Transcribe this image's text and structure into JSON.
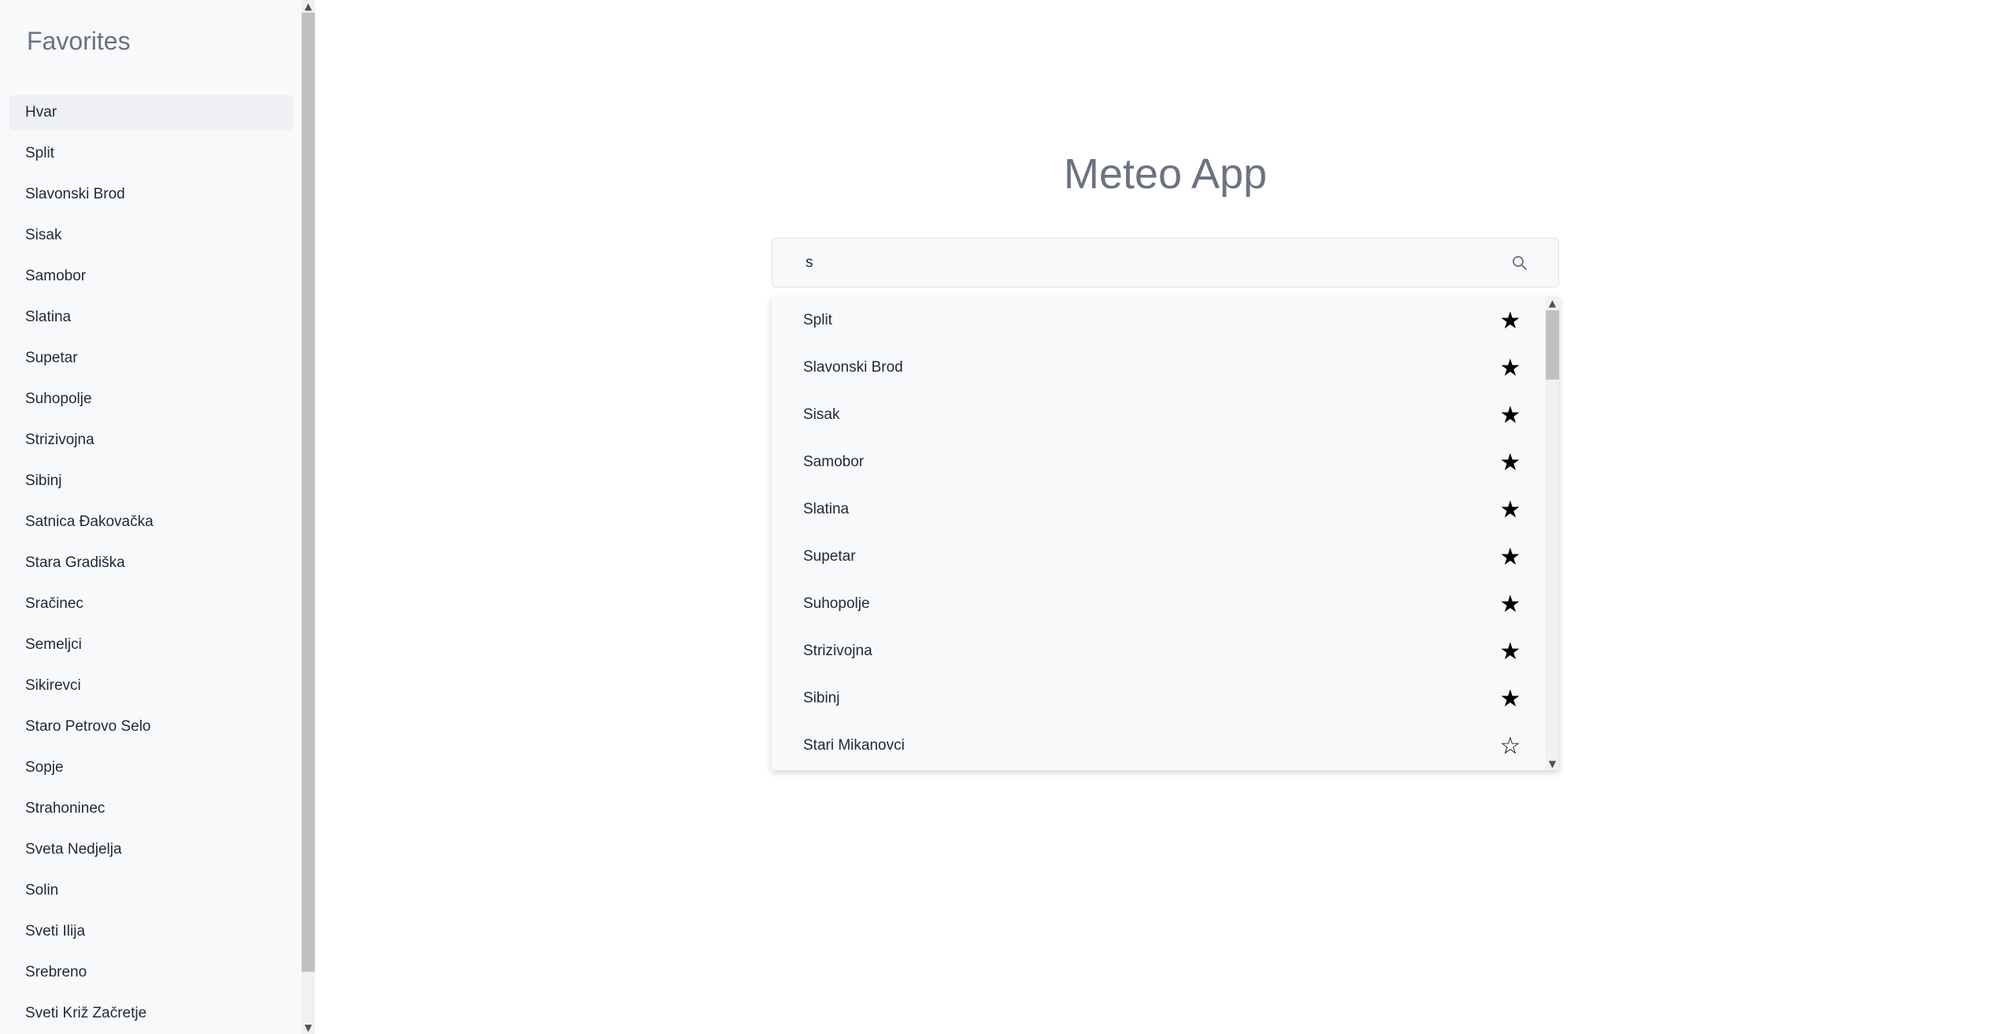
{
  "sidebar": {
    "title": "Favorites",
    "items": [
      {
        "label": "Hvar"
      },
      {
        "label": "Split"
      },
      {
        "label": "Slavonski Brod"
      },
      {
        "label": "Sisak"
      },
      {
        "label": "Samobor"
      },
      {
        "label": "Slatina"
      },
      {
        "label": "Supetar"
      },
      {
        "label": "Suhopolje"
      },
      {
        "label": "Strizivojna"
      },
      {
        "label": "Sibinj"
      },
      {
        "label": "Satnica Đakovačka"
      },
      {
        "label": "Stara Gradiška"
      },
      {
        "label": "Sračinec"
      },
      {
        "label": "Semeljci"
      },
      {
        "label": "Sikirevci"
      },
      {
        "label": "Staro Petrovo Selo"
      },
      {
        "label": "Sopje"
      },
      {
        "label": "Strahoninec"
      },
      {
        "label": "Sveta Nedjelja"
      },
      {
        "label": "Solin"
      },
      {
        "label": "Sveti Ilija"
      },
      {
        "label": "Srebreno"
      },
      {
        "label": "Sveti Križ Začretje"
      }
    ]
  },
  "main": {
    "title": "Meteo App",
    "search": {
      "value": "s",
      "icon": "search-icon"
    },
    "results": [
      {
        "label": "Split",
        "favorite": true
      },
      {
        "label": "Slavonski Brod",
        "favorite": true
      },
      {
        "label": "Sisak",
        "favorite": true
      },
      {
        "label": "Samobor",
        "favorite": true
      },
      {
        "label": "Slatina",
        "favorite": true
      },
      {
        "label": "Supetar",
        "favorite": true
      },
      {
        "label": "Suhopolje",
        "favorite": true
      },
      {
        "label": "Strizivojna",
        "favorite": true
      },
      {
        "label": "Sibinj",
        "favorite": true
      },
      {
        "label": "Stari Mikanovci",
        "favorite": false
      }
    ]
  },
  "glyphs": {
    "star_filled": "★",
    "star_empty": "☆",
    "arrow_up": "▲",
    "arrow_down": "▼"
  },
  "colors": {
    "sidebar_bg": "#f8f9fa",
    "title_gray": "#6b7280",
    "active_item_bg": "#eef0f3"
  }
}
